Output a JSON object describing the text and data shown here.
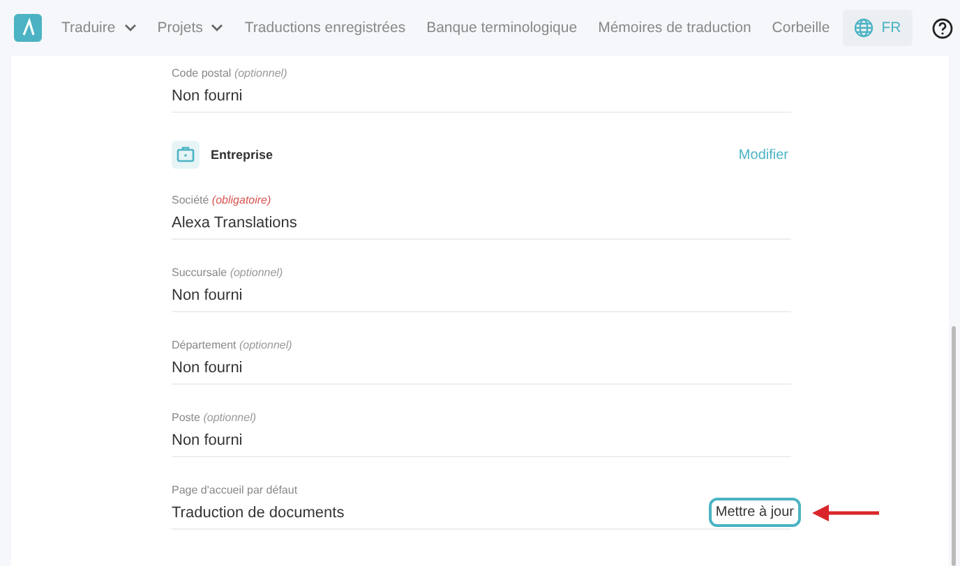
{
  "nav": {
    "items": [
      {
        "label": "Traduire",
        "dropdown": true
      },
      {
        "label": "Projets",
        "dropdown": true
      },
      {
        "label": "Traductions enregistrées",
        "dropdown": false
      },
      {
        "label": "Banque terminologique",
        "dropdown": false
      },
      {
        "label": "Mémoires de traduction",
        "dropdown": false
      },
      {
        "label": "Corbeille",
        "dropdown": false
      }
    ],
    "language": "FR"
  },
  "rows": [
    {
      "kind": "field",
      "label": "Code postal",
      "note": "(optionnel)",
      "required": false,
      "value": "Non fourni"
    },
    {
      "kind": "section",
      "title": "Entreprise",
      "action": "Modifier"
    },
    {
      "kind": "field",
      "label": "Société",
      "note": "(obligatoire)",
      "required": true,
      "value": "Alexa Translations"
    },
    {
      "kind": "field",
      "label": "Succursale",
      "note": "(optionnel)",
      "required": false,
      "value": "Non fourni"
    },
    {
      "kind": "field",
      "label": "Département",
      "note": "(optionnel)",
      "required": false,
      "value": "Non fourni"
    },
    {
      "kind": "field",
      "label": "Poste",
      "note": "(optionnel)",
      "required": false,
      "value": "Non fourni"
    },
    {
      "kind": "field",
      "label": "Page d'accueil par défaut",
      "value": "Traduction de documents",
      "button": "Mettre à jour",
      "highlighted": true
    }
  ]
}
